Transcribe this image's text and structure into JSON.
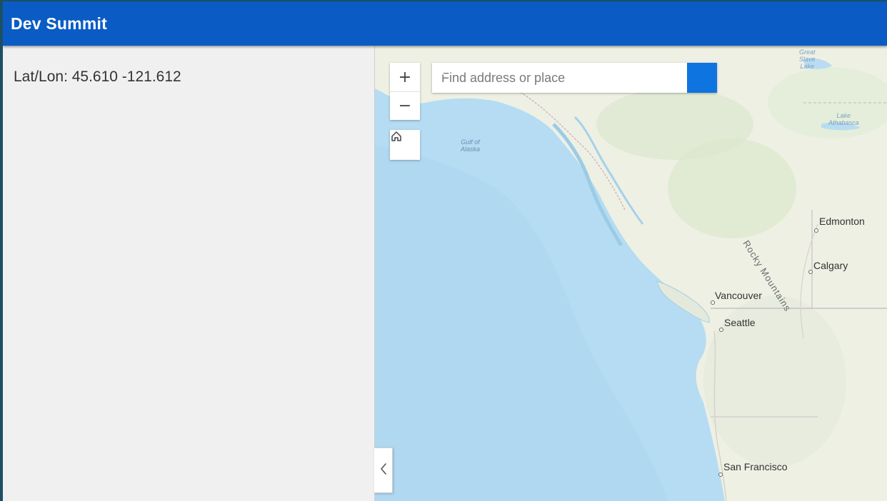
{
  "header": {
    "title": "Dev Summit"
  },
  "sidebar": {
    "coords_text": "Lat/Lon: 45.610 -121.612"
  },
  "map": {
    "zoom_in_label": "+",
    "zoom_out_label": "−",
    "search": {
      "placeholder": "Find address or place",
      "value": ""
    },
    "labels": {
      "great_slave_lake": [
        "Great",
        "Slave",
        "Lake"
      ],
      "lake_athabasca": [
        "Lake",
        "Athabasca"
      ],
      "gulf_of_alaska": [
        "Gulf of",
        "Alaska"
      ],
      "rocky_mountains": "Rocky Mountains",
      "cities": {
        "edmonton": "Edmonton",
        "calgary": "Calgary",
        "vancouver": "Vancouver",
        "seattle": "Seattle",
        "san_francisco": "San Francisco"
      }
    },
    "icons": [
      "plus-icon",
      "minus-icon",
      "home-icon",
      "search-icon",
      "chevron-left-icon"
    ],
    "colors": {
      "ocean": "#b5dcf3",
      "land": "#eef0e4",
      "header": "#0a5cc4",
      "search_button": "#0e74e0"
    }
  }
}
